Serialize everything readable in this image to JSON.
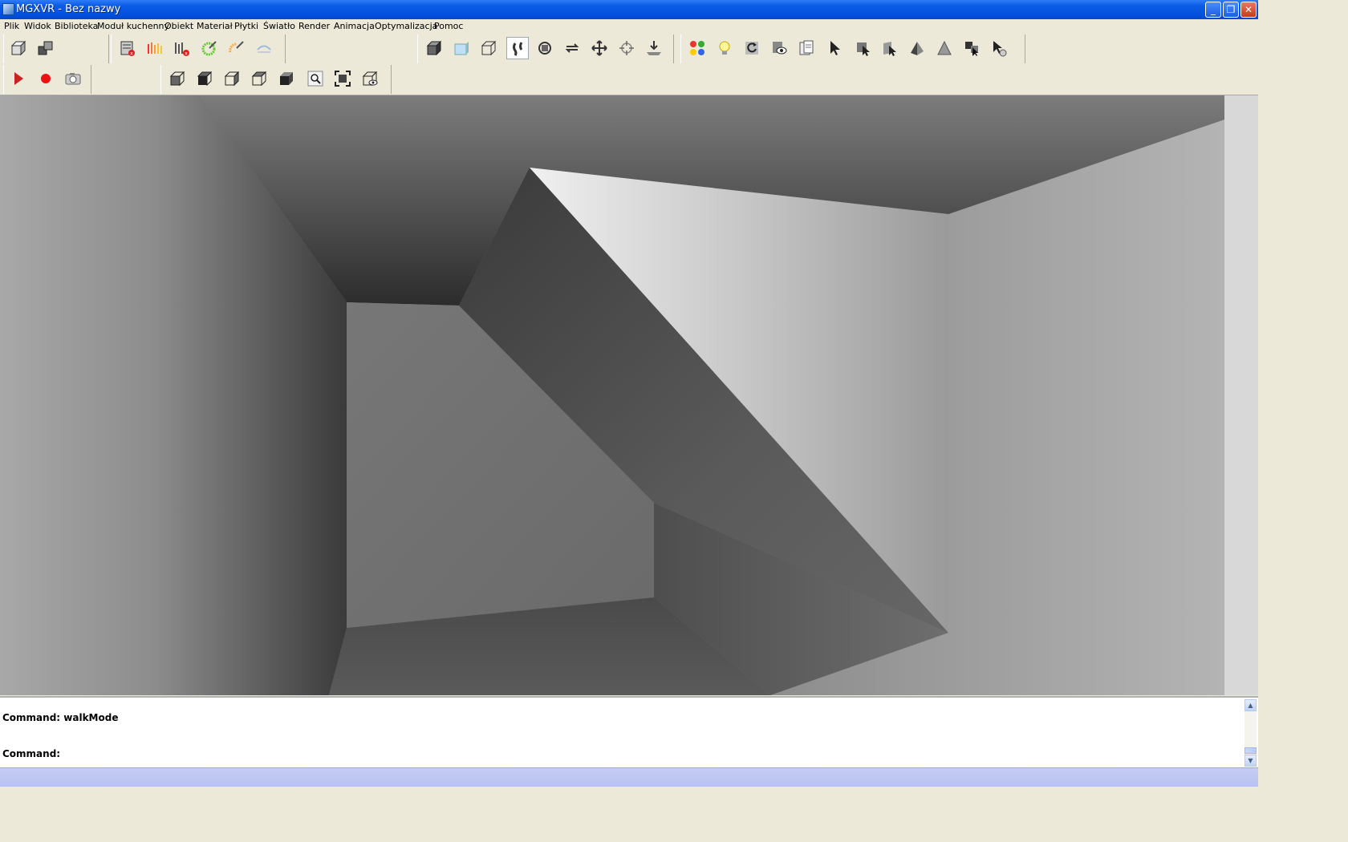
{
  "window": {
    "title": "MGXVR - Bez nazwy",
    "minimize": "_",
    "restore": "❐",
    "close": "✕"
  },
  "menu": [
    "Plik",
    "Widok",
    "Biblioteka",
    "Moduł kuchenny",
    "Obiekt",
    "Materiał",
    "Płytki",
    "Światło",
    "Render",
    "Animacja",
    "Optymalizacja",
    "Pomoc"
  ],
  "command": {
    "line1": "Command: walkMode",
    "line2": "Command:"
  },
  "scrollbar": {
    "up": "▲",
    "down": "▼"
  },
  "icons": {
    "toolbar_row1": [
      "new-object-icon",
      "copy-object-icon",
      "delete-list-icon",
      "material-stripes-icon",
      "delete-stripes-icon",
      "light-burst-icon",
      "light-partial-icon",
      "light-dim-icon",
      "shaded-box-icon",
      "solid-box-icon",
      "wireframe-box-icon",
      "walk-mode-icon",
      "orbit-icon",
      "rotate-icon",
      "pan-icon",
      "zoom-target-icon",
      "drop-to-floor-icon",
      "materials-balls-icon",
      "light-bulb-icon",
      "refresh-render-icon",
      "eye-view-icon",
      "layers-icon",
      "select-arrow-icon",
      "select-object-icon",
      "select-face-icon",
      "pyramid-icon",
      "triangle-icon",
      "group-select-icon",
      "deselect-icon"
    ],
    "toolbar_row2": [
      "play-icon",
      "record-icon",
      "camera-icon",
      "view-front-icon",
      "view-top-icon",
      "view-left-icon",
      "view-right-icon",
      "view-solid-icon",
      "zoom-magnifier-icon",
      "zoom-extents-icon",
      "perspective-view-icon"
    ]
  }
}
